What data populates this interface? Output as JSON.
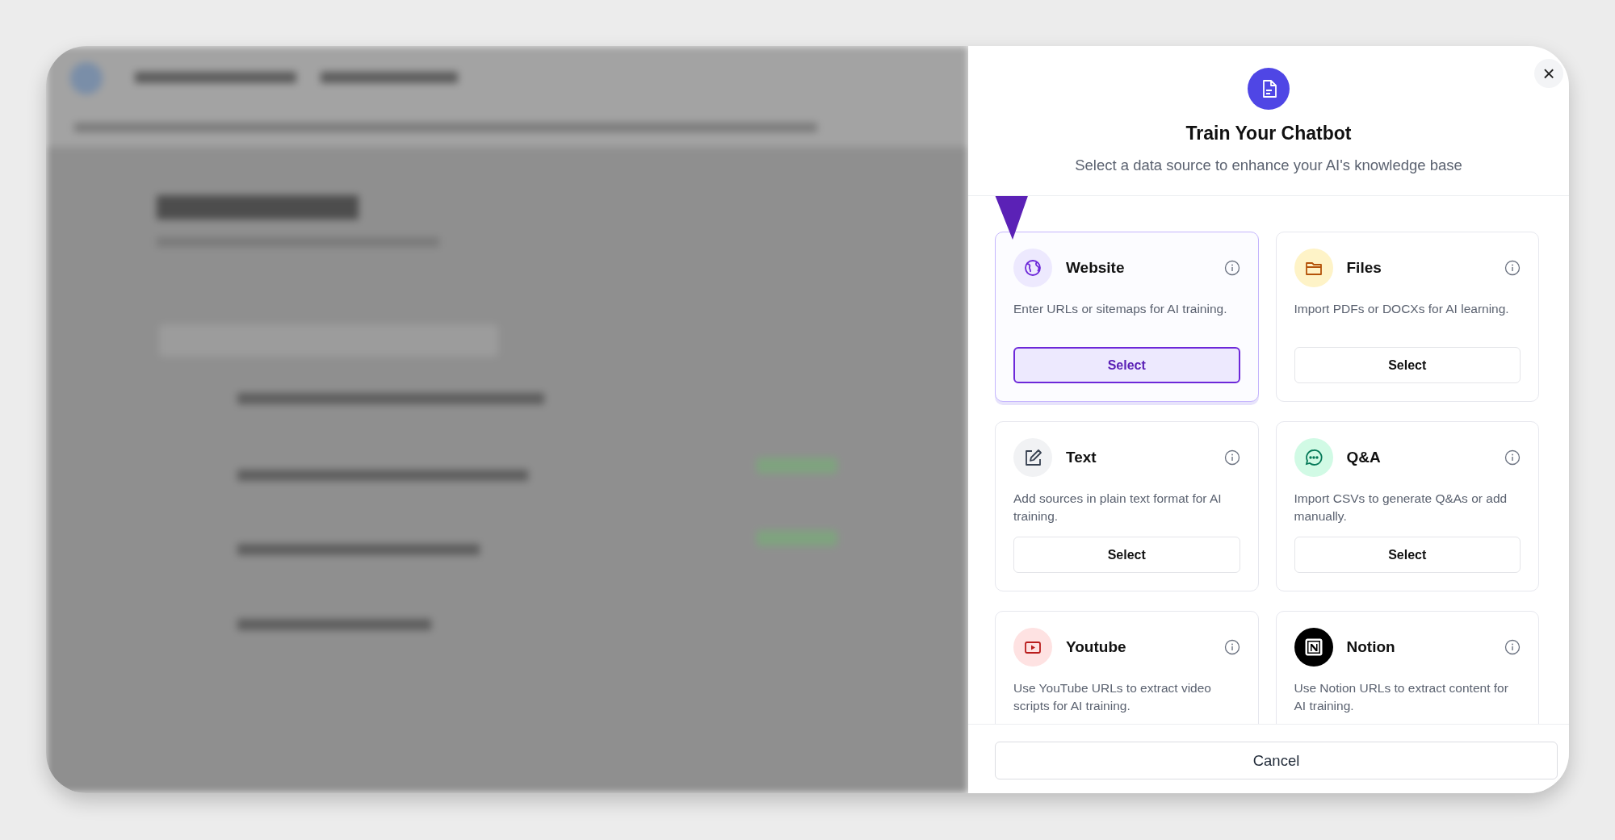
{
  "dialog": {
    "title": "Train Your Chatbot",
    "subtitle": "Select a data source to enhance your AI's knowledge base",
    "close": "×",
    "sources": [
      {
        "kind": "globe",
        "name": "Website",
        "description": "Enter URLs or sitemaps for AI training.",
        "button": "Select",
        "selected": true
      },
      {
        "kind": "folder",
        "name": "Files",
        "description": "Import PDFs or DOCXs for AI learning.",
        "button": "Select",
        "selected": false
      },
      {
        "kind": "pencil",
        "name": "Text",
        "description": "Add sources in plain text format for AI training.",
        "button": "Select",
        "selected": false
      },
      {
        "kind": "chat",
        "name": "Q&A",
        "description": "Import CSVs to generate Q&As or add manually.",
        "button": "Select",
        "selected": false
      },
      {
        "kind": "play",
        "name": "Youtube",
        "description": "Use YouTube URLs to extract video scripts for AI training.",
        "selected": false
      },
      {
        "kind": "notion",
        "name": "Notion",
        "description": "Use Notion URLs to extract content for AI training.",
        "selected": false
      }
    ],
    "cancel": "Cancel"
  }
}
